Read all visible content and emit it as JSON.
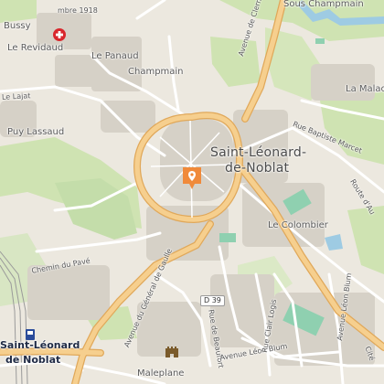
{
  "map": {
    "places": {
      "bussy": "Bussy",
      "le_revidaud": "Le Revidaud",
      "le_panaud": "Le Panaud",
      "champmain": "Champmain",
      "sous_champmain": "Sous Champmain",
      "la_malacu": "La Malacu",
      "puy_lassaud": "Puy Lassaud",
      "le_lajat": "Le Lajat",
      "saint_leonard": "Saint-Léonard-",
      "de_noblat": "de-Noblat",
      "le_colombier": "Le Colombier",
      "maleplane": "Maleplane",
      "station_line1": "Saint-Léonard",
      "station_line2": "de Noblat"
    },
    "roads": {
      "avenue_clermont": "Avenue de Clermont",
      "rue_baptiste_marcet": "Rue Baptiste Marcet",
      "route_aub": "Route d'Au",
      "chemin_pave": "Chemin du Pavé",
      "avenue_gaulle": "Avenue du Général de Gaulle",
      "rue_beaufort": "Rue de Beaufort",
      "avenue_leon_blum": "Avenue Léon Blum",
      "rue_clair_logis": "Rue Clair Logis",
      "avenue_leon_blum_2": "Avenue Léon Blum",
      "rue_11_nov": "mbre 1918",
      "d39": "D 39",
      "cite": "Cité"
    },
    "colors": {
      "background": "#ece8df",
      "forest": "#cfe3b2",
      "water": "#9ecbe3",
      "major_road": "#f6cf8e",
      "major_road_casing": "#e0a85a",
      "minor_road": "#ffffff",
      "building": "#d6d1c7",
      "sport": "#8fd0b0",
      "marker": "#f08a3a",
      "hospital": "#d9262c"
    },
    "icons": {
      "location_marker": "location-pin-icon",
      "hospital": "hospital-cross-icon",
      "castle": "castle-icon",
      "train_station": "train-station-icon"
    }
  }
}
